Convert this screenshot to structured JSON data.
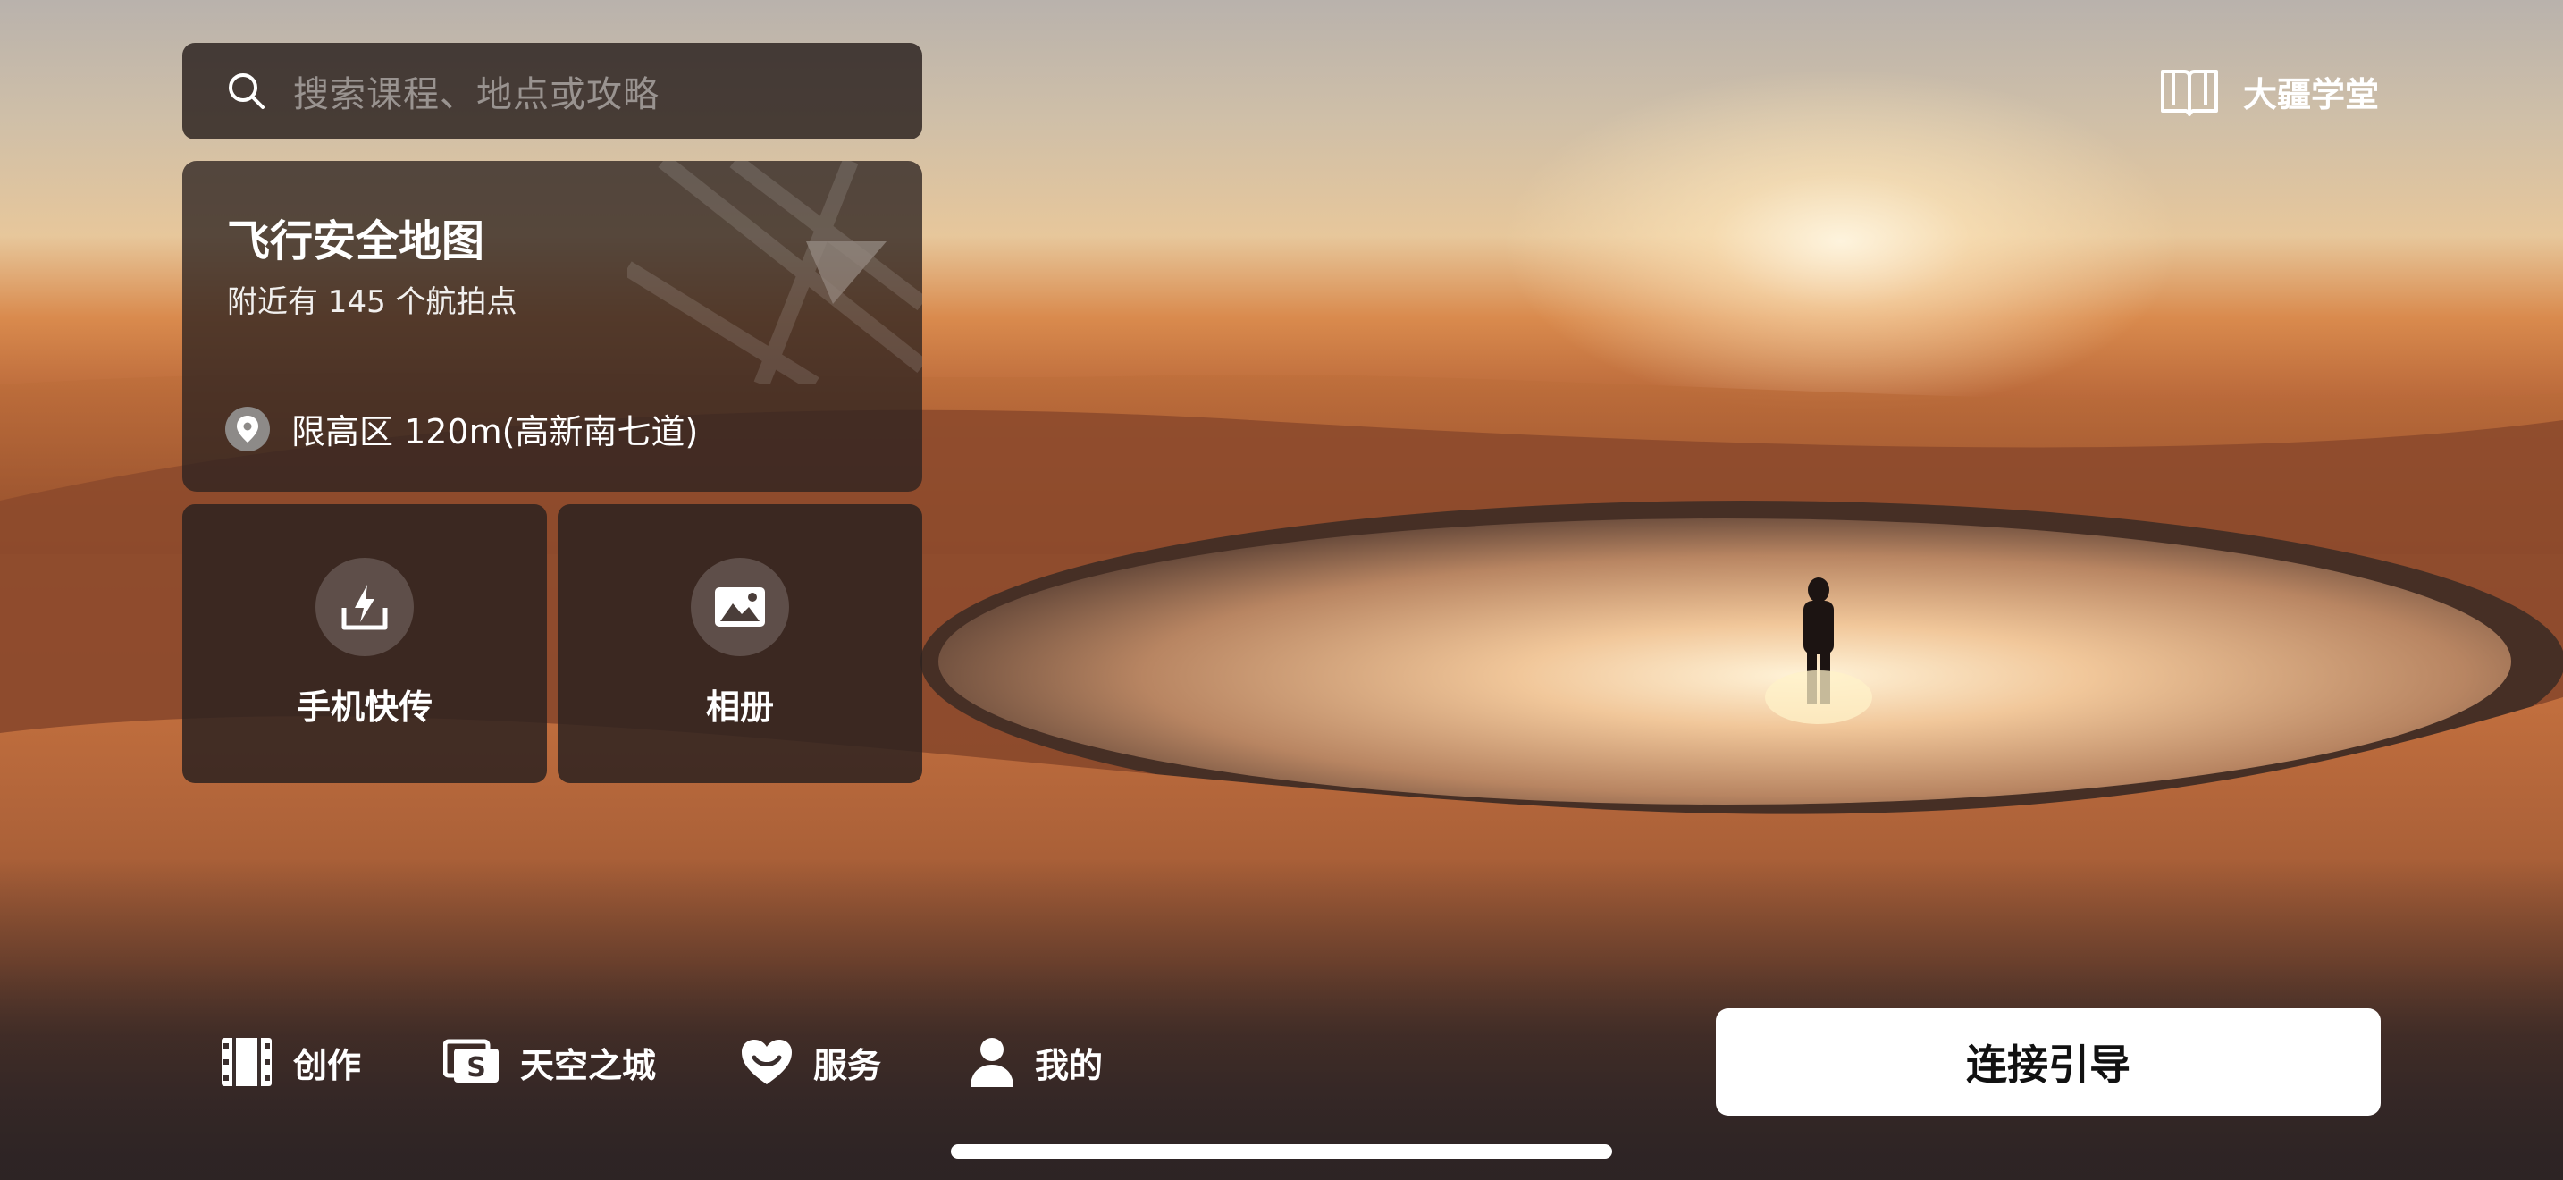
{
  "search": {
    "placeholder": "搜索课程、地点或攻略",
    "icon": "search-icon"
  },
  "header": {
    "academy_label": "大疆学堂",
    "academy_icon": "book-icon"
  },
  "map_card": {
    "title": "飞行安全地图",
    "subtitle": "附近有 145 个航拍点",
    "restriction": "限高区 120m(高新南七道)",
    "pin_icon": "location-pin-icon"
  },
  "tiles": [
    {
      "label": "手机快传",
      "icon": "quick-transfer-icon"
    },
    {
      "label": "相册",
      "icon": "album-icon"
    }
  ],
  "bottom_nav": [
    {
      "label": "创作",
      "icon": "film-icon"
    },
    {
      "label": "天空之城",
      "icon": "skypixel-icon"
    },
    {
      "label": "服务",
      "icon": "heart-service-icon"
    },
    {
      "label": "我的",
      "icon": "user-icon"
    }
  ],
  "connect_button": {
    "label": "连接引导"
  },
  "colors": {
    "card_bg": "#2d2220",
    "button_bg": "#ffffff",
    "button_text": "#111111",
    "accent_sand": "#b9683a"
  }
}
